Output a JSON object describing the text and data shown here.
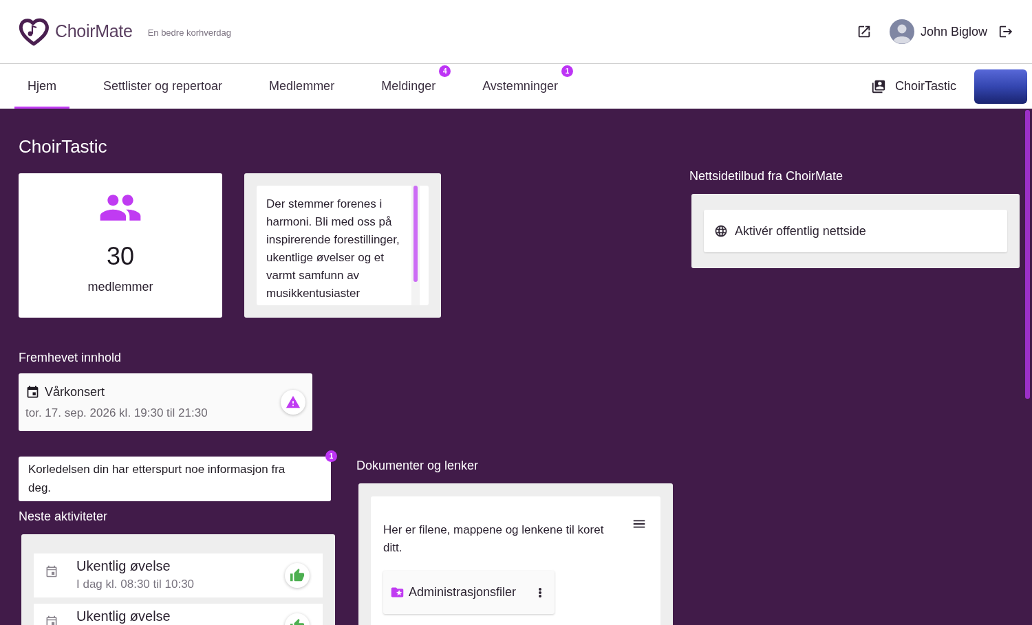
{
  "header": {
    "logo_text": "ChoirMate",
    "tagline": "En bedre korhverdag",
    "user_name": "John Biglow"
  },
  "tabs": [
    {
      "label": "Hjem",
      "selected": true
    },
    {
      "label": "Settlister og repertoar",
      "selected": false
    },
    {
      "label": "Medlemmer",
      "selected": false
    },
    {
      "label": "Meldinger",
      "selected": false,
      "badge": "4"
    },
    {
      "label": "Avstemninger",
      "selected": false,
      "badge": "1"
    }
  ],
  "choir_switcher": {
    "label": "ChoirTastic"
  },
  "page_title": "ChoirTastic",
  "members_card": {
    "count": "30",
    "label": "medlemmer"
  },
  "description": "Der stemmer forenes i harmoni. Bli med oss på inspirerende forestillinger, ukentlige øvelser og et varmt samfunn av musikkentusiaster",
  "featured": {
    "heading": "Fremhevet innhold",
    "items": [
      {
        "title": "Vårkonsert",
        "time": "tor. 17. sep. 2026 kl. 19:30 til 21:30",
        "responded": false
      }
    ]
  },
  "notice": {
    "text": "Korledelsen din har etterspurt noe informasjon fra deg.",
    "badge": "1"
  },
  "activities": {
    "heading": "Neste aktiviteter",
    "items": [
      {
        "title": "Ukentlig øvelse",
        "time": "I dag kl. 08:30 til 10:30",
        "responded": true,
        "attending": true
      },
      {
        "title": "Ukentlig øvelse",
        "responded": true,
        "attending": true
      }
    ]
  },
  "documents": {
    "heading": "Dokumenter og lenker",
    "intro": "Her er filene, mappene og lenkene til koret ditt.",
    "items": [
      {
        "name": "Administrasjonsfiler"
      }
    ]
  },
  "website_offer": {
    "heading": "Nettsidetilbud fra ChoirMate",
    "button": "Aktivér offentlig nettside"
  }
}
